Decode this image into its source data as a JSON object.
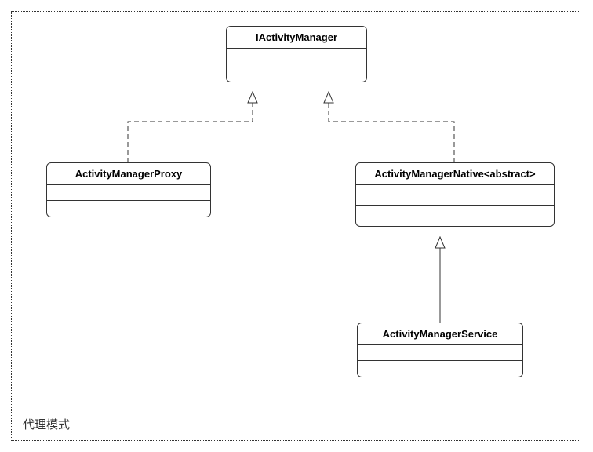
{
  "container": {
    "label": "代理模式"
  },
  "classes": {
    "interface": {
      "name": "IActivityManager"
    },
    "proxy": {
      "name": "ActivityManagerProxy"
    },
    "native": {
      "name": "ActivityManagerNative<abstract>"
    },
    "service": {
      "name": "ActivityManagerService"
    }
  }
}
